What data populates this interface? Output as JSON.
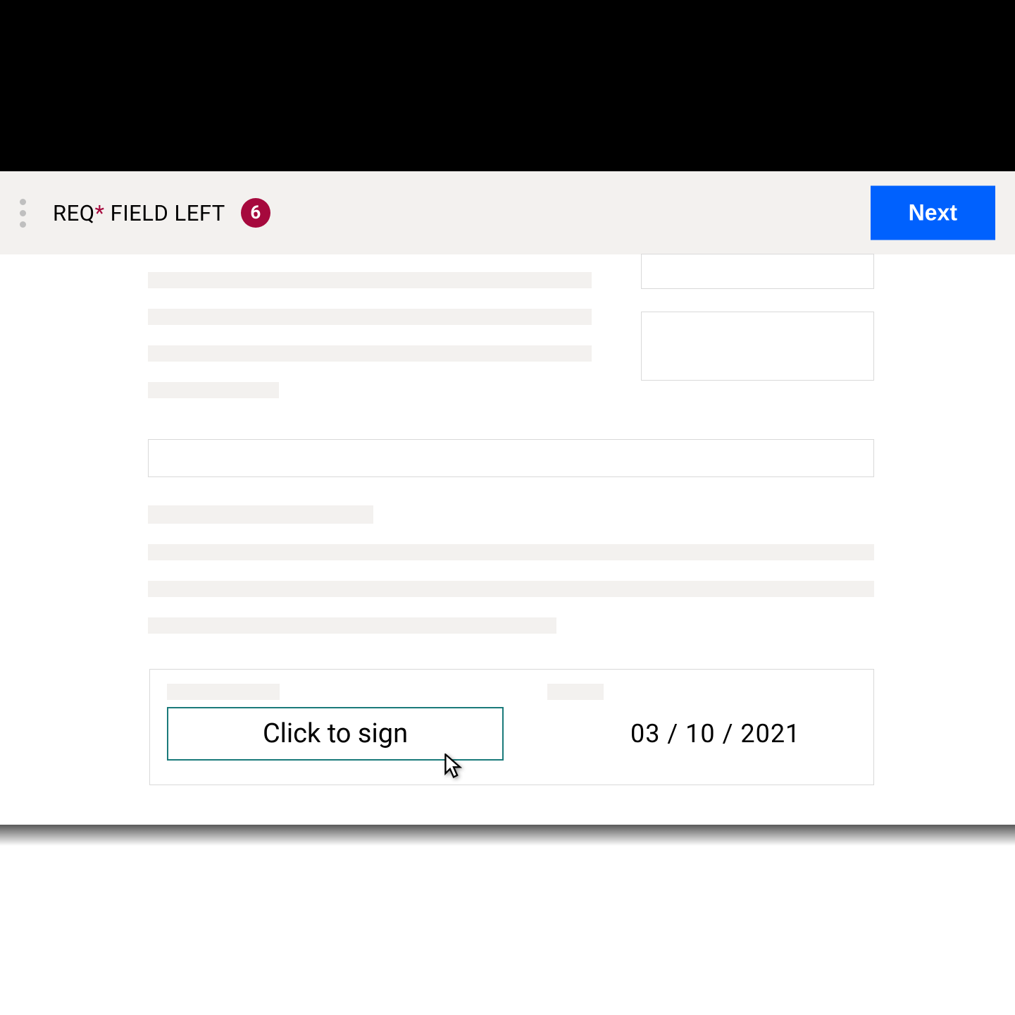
{
  "header": {
    "req_label_prefix": "REQ",
    "req_label_suffix": " FIELD LEFT",
    "count_badge": "6",
    "next_button_label": "Next"
  },
  "signature": {
    "sign_button_label": "Click to sign",
    "date_value": "03 / 10 / 2021"
  },
  "colors": {
    "accent_blue": "#0061fe",
    "accent_red": "#a6093d",
    "sign_border": "#1a7a7a",
    "placeholder": "#f3f1ef"
  }
}
